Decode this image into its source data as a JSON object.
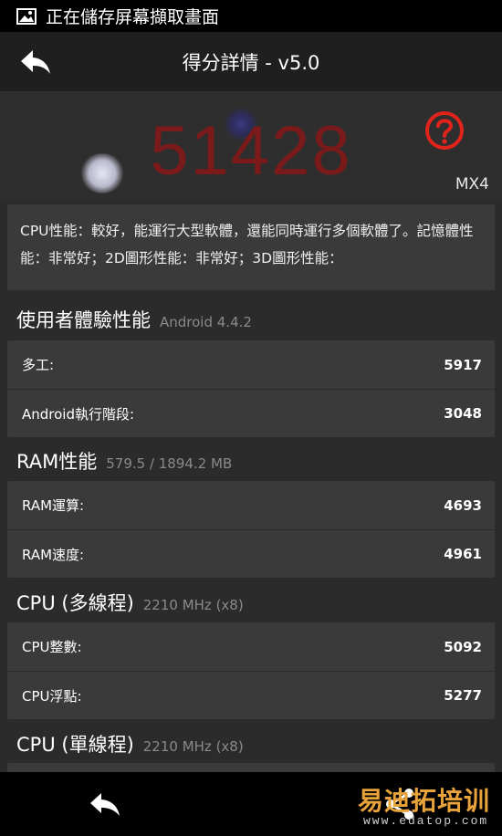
{
  "status_bar": {
    "text": "正在儲存屏幕擷取畫面",
    "icon": "image-icon"
  },
  "app_bar": {
    "title": "得分詳情 - v5.0",
    "back_icon": "back-arrow-icon"
  },
  "score": {
    "value": "51428",
    "model": "MX4",
    "help_icon": "question-icon"
  },
  "description": "CPU性能：較好，能運行大型軟體，還能同時運行多個軟體了。記憶體性能：非常好；2D圖形性能：非常好；3D圖形性能：",
  "sections": {
    "ux": {
      "title": "使用者體驗性能",
      "subtitle": "Android 4.4.2",
      "rows": [
        {
          "label": "多工:",
          "value": "5917"
        },
        {
          "label": "Android執行階段:",
          "value": "3048"
        }
      ]
    },
    "ram": {
      "title": "RAM性能",
      "subtitle": "579.5 / 1894.2 MB",
      "rows": [
        {
          "label": "RAM運算:",
          "value": "4693"
        },
        {
          "label": "RAM速度:",
          "value": "4961"
        }
      ]
    },
    "cpu_multi": {
      "title": "CPU (多線程)",
      "subtitle": "2210 MHz (x8)",
      "rows": [
        {
          "label": "CPU整數:",
          "value": "5092"
        },
        {
          "label": "CPU浮點:",
          "value": "5277"
        }
      ]
    },
    "cpu_single": {
      "title": "CPU (單線程)",
      "subtitle": "2210 MHz (x8)"
    }
  },
  "nav_bar": {
    "back_icon": "back-icon",
    "share_icon": "share-icon"
  },
  "watermark": {
    "top": "易迪拓培训",
    "bottom": "www.edatop.com"
  },
  "colors": {
    "score": "#7a1a1a",
    "help": "#e0241c",
    "card": "#3a3a3a",
    "background": "#2b2b2b"
  }
}
